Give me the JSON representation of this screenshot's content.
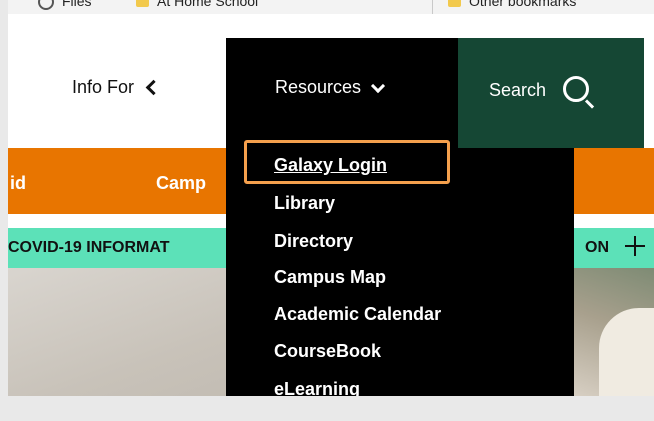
{
  "bookmarks": {
    "items": [
      {
        "label": "Files"
      },
      {
        "label": "At Home School"
      },
      {
        "label": "Other bookmarks"
      }
    ]
  },
  "nav": {
    "info_for": "Info For",
    "resources": "Resources",
    "search": "Search"
  },
  "orange_bar": {
    "left_text": "id",
    "middle_text": "Camp"
  },
  "covid_banner": {
    "left_text": "COVID-19 INFORMAT",
    "right_text": "ON"
  },
  "dropdown": {
    "items": [
      {
        "label": "Galaxy Login"
      },
      {
        "label": "Library"
      },
      {
        "label": "Directory"
      },
      {
        "label": "Campus Map"
      },
      {
        "label": "Academic Calendar"
      },
      {
        "label": "CourseBook"
      },
      {
        "label": "eLearning"
      }
    ]
  },
  "colors": {
    "orange": "#e87500",
    "green": "#154734",
    "teal": "#5ce1b8",
    "highlight": "#f5a04d"
  }
}
